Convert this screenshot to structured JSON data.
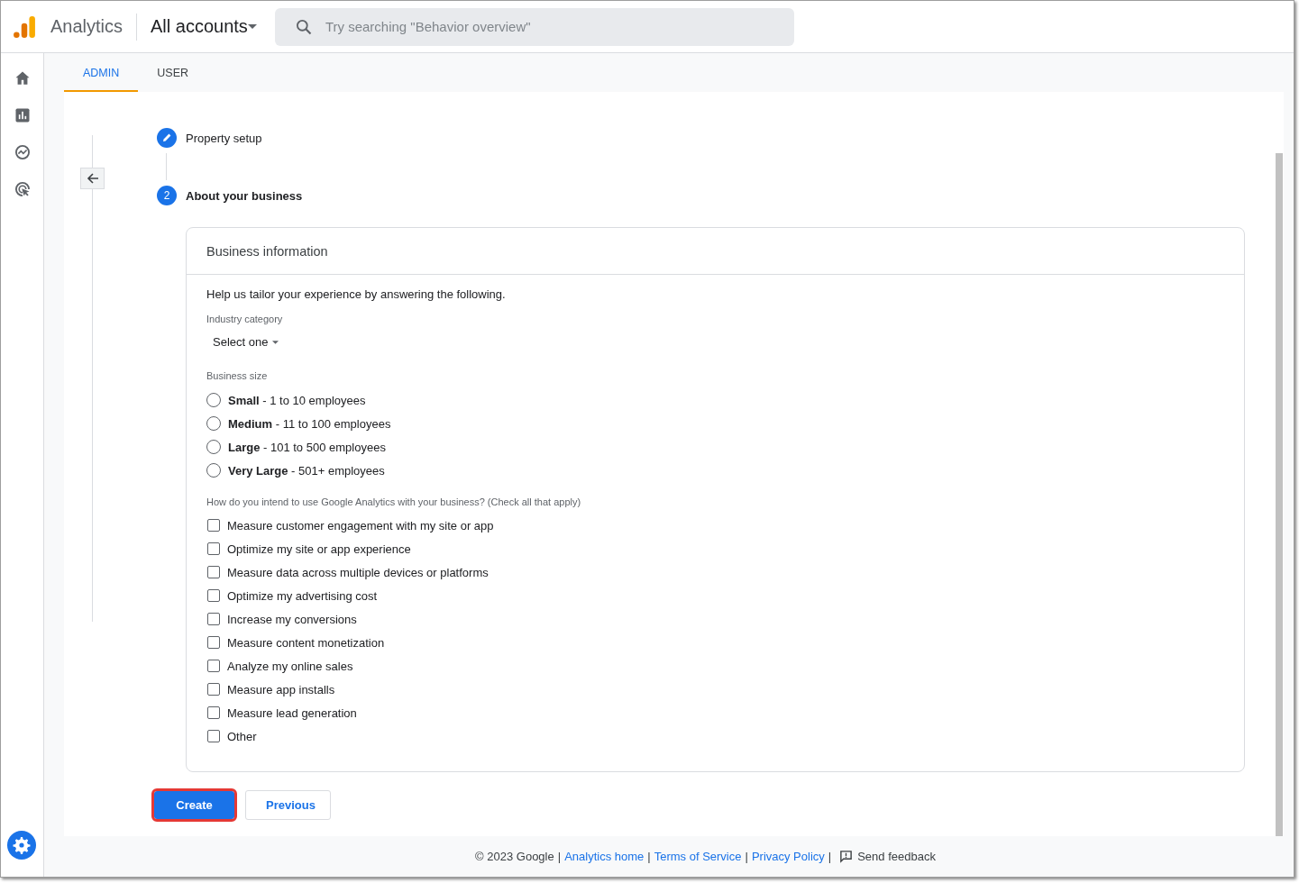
{
  "header": {
    "product": "Analytics",
    "account_picker": "All accounts",
    "search": {
      "placeholder": "Try searching \"Behavior overview\""
    }
  },
  "tabs": [
    {
      "label": "ADMIN",
      "selected": true
    },
    {
      "label": "USER",
      "selected": false
    }
  ],
  "steps": [
    {
      "kind": "done",
      "label": "Property setup"
    },
    {
      "kind": "current",
      "number": "2",
      "label": "About your business"
    }
  ],
  "card": {
    "title": "Business information",
    "intro": "Help us tailor your experience by answering the following.",
    "industry": {
      "label": "Industry category",
      "value": "Select one"
    },
    "size": {
      "label": "Business size",
      "options": [
        {
          "label": "**Small** - 1 to 10 employees",
          "selected": false
        },
        {
          "label": "**Medium** - 11 to 100 employees",
          "selected": false
        },
        {
          "label": "**Large** - 101 to 500 employees",
          "selected": false
        },
        {
          "label": "**Very Large** - 501+ employees",
          "selected": false
        }
      ]
    },
    "usage": {
      "label": "How do you intend to use Google Analytics with your business? (Check all that apply)",
      "options": [
        {
          "label": "Measure customer engagement with my site or app",
          "checked": false
        },
        {
          "label": "Optimize my site or app experience",
          "checked": false
        },
        {
          "label": "Measure data across multiple devices or platforms",
          "checked": false
        },
        {
          "label": "Optimize my advertising cost",
          "checked": false
        },
        {
          "label": "Increase my conversions",
          "checked": false
        },
        {
          "label": "Measure content monetization",
          "checked": false
        },
        {
          "label": "Analyze my online sales",
          "checked": false
        },
        {
          "label": "Measure app installs",
          "checked": false
        },
        {
          "label": "Measure lead generation",
          "checked": false
        },
        {
          "label": "Other",
          "checked": false
        }
      ]
    }
  },
  "buttons": [
    {
      "kind": "primary",
      "label": "Create",
      "highlighted": true
    },
    {
      "kind": "secondary",
      "label": "Previous",
      "highlighted": false
    }
  ],
  "footer": [
    {
      "kind": "text",
      "text": "© 2023 Google"
    },
    {
      "kind": "separator",
      "text": "|"
    },
    {
      "kind": "link",
      "text": "Analytics home"
    },
    {
      "kind": "separator",
      "text": "|"
    },
    {
      "kind": "link",
      "text": "Terms of Service"
    },
    {
      "kind": "separator",
      "text": "|"
    },
    {
      "kind": "link",
      "text": "Privacy Policy"
    },
    {
      "kind": "separator",
      "text": "|"
    },
    {
      "kind": "feedback",
      "text": "Send feedback"
    }
  ]
}
